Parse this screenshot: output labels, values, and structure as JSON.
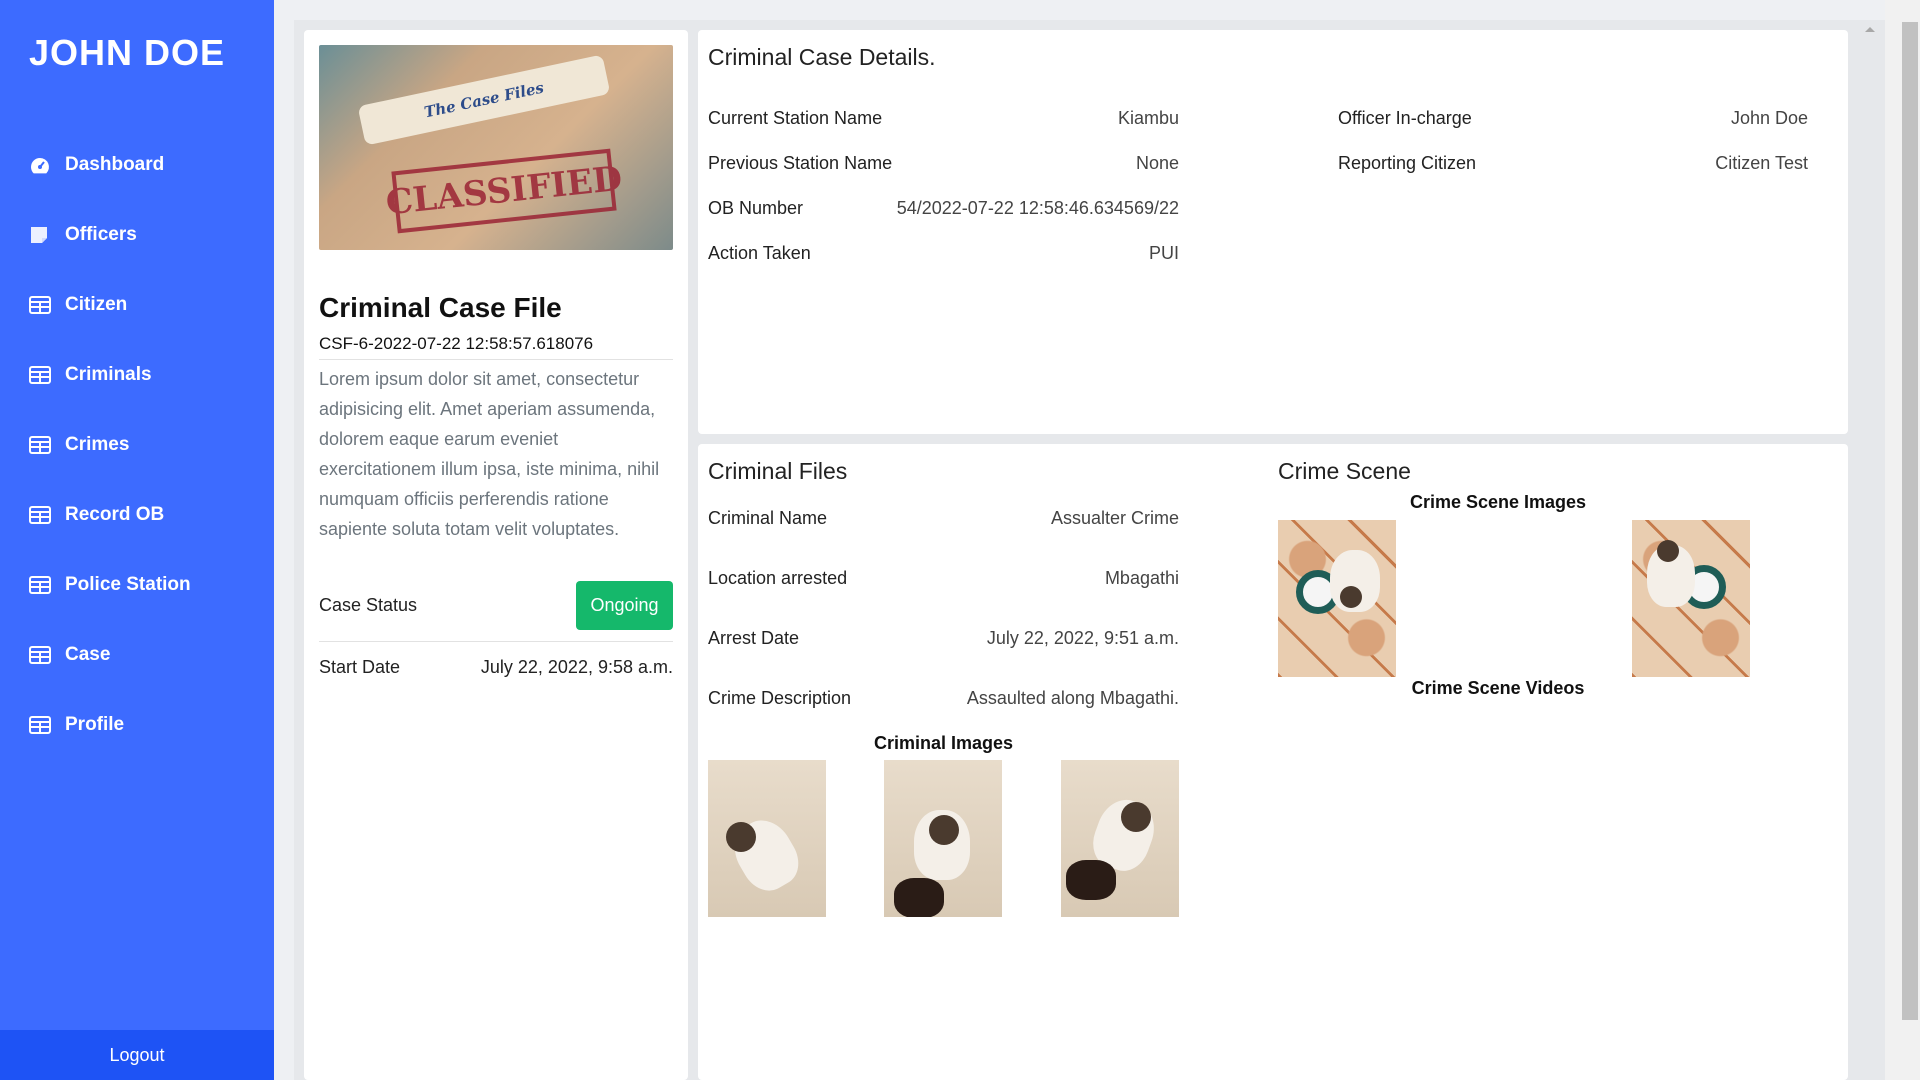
{
  "sidebar": {
    "brand": "JOHN DOE",
    "items": [
      {
        "label": "Dashboard",
        "icon": "dashboard-gauge-icon"
      },
      {
        "label": "Officers",
        "icon": "note-icon"
      },
      {
        "label": "Citizen",
        "icon": "table-icon"
      },
      {
        "label": "Criminals",
        "icon": "table-icon"
      },
      {
        "label": "Crimes",
        "icon": "table-icon"
      },
      {
        "label": "Record OB",
        "icon": "table-icon"
      },
      {
        "label": "Police Station",
        "icon": "table-icon"
      },
      {
        "label": "Case",
        "icon": "table-icon"
      },
      {
        "label": "Profile",
        "icon": "table-icon"
      }
    ],
    "logout": "Logout"
  },
  "case_file": {
    "image_alt": "The Case Files CLASSIFIED",
    "image_tab_text": "The Case Files",
    "image_stamp_text": "CLASSIFIED",
    "title": "Criminal Case File",
    "code": "CSF-6-2022-07-22 12:58:57.618076",
    "description": "Lorem ipsum dolor sit amet, consectetur adipisicing elit. Amet aperiam assumenda, dolorem eaque earum eveniet exercitationem illum ipsa, iste minima, nihil numquam officiis perferendis ratione sapiente soluta totam velit voluptates.",
    "status_label": "Case Status",
    "status_value": "Ongoing",
    "start_label": "Start Date",
    "start_value": "July 22, 2022, 9:58 a.m."
  },
  "details": {
    "title": "Criminal Case Details.",
    "left": [
      {
        "label": "Current Station Name",
        "value": "Kiambu"
      },
      {
        "label": "Previous Station Name",
        "value": "None"
      },
      {
        "label": "OB Number",
        "value": "54/2022-07-22 12:58:46.634569/22"
      },
      {
        "label": "Action Taken",
        "value": "PUI"
      }
    ],
    "right": [
      {
        "label": "Officer In-charge",
        "value": "John Doe"
      },
      {
        "label": "Reporting Citizen",
        "value": "Citizen Test"
      }
    ]
  },
  "criminal_files": {
    "title": "Criminal Files",
    "rows": [
      {
        "label": "Criminal Name",
        "value": "Assualter Crime"
      },
      {
        "label": "Location arrested",
        "value": "Mbagathi"
      },
      {
        "label": "Arrest Date",
        "value": "July 22, 2022, 9:51 a.m."
      },
      {
        "label": "Crime Description",
        "value": "Assaulted along Mbagathi."
      }
    ],
    "images_label": "Criminal Images"
  },
  "crime_scene": {
    "title": "Crime Scene",
    "images_label": "Crime Scene Images",
    "videos_label": "Crime Scene Videos"
  },
  "colors": {
    "sidebar": "#3d6bff",
    "logout_bg": "#1e53f5",
    "status_badge": "#15b86b",
    "background": "#eef0f3"
  }
}
